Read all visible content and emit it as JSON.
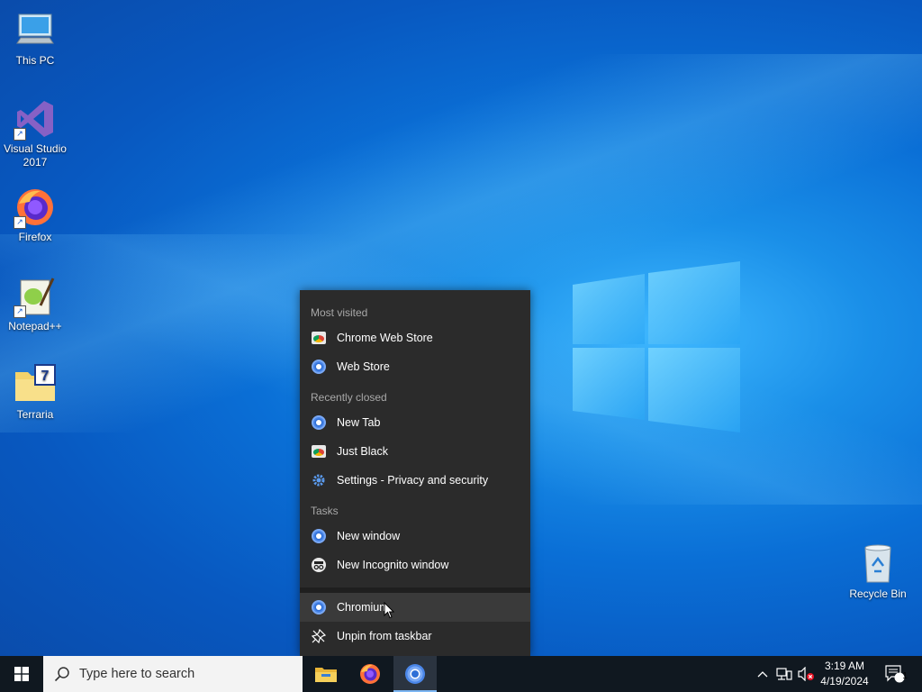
{
  "desktop": {
    "icons": [
      {
        "label": "This PC",
        "icon": "computer-icon"
      },
      {
        "label": "Visual Studio 2017",
        "icon": "visual-studio-icon"
      },
      {
        "label": "Firefox",
        "icon": "firefox-icon"
      },
      {
        "label": "Notepad++",
        "icon": "notepadpp-icon"
      },
      {
        "label": "Terraria",
        "icon": "folder-icon"
      },
      {
        "label": "Recycle Bin",
        "icon": "recycle-bin-icon"
      }
    ]
  },
  "jumplist": {
    "most_visited_header": "Most visited",
    "most_visited": [
      "Chrome Web Store",
      "Web Store"
    ],
    "recently_closed_header": "Recently closed",
    "recently_closed": [
      "New Tab",
      "Just Black",
      "Settings - Privacy and security"
    ],
    "tasks_header": "Tasks",
    "tasks": [
      "New window",
      "New Incognito window"
    ],
    "app_name": "Chromium",
    "unpin_label": "Unpin from taskbar"
  },
  "taskbar": {
    "search_placeholder": "Type here to search",
    "time": "3:19 AM",
    "date": "4/19/2024",
    "notification_count": "1",
    "accent_color": "#7cb6f2"
  }
}
